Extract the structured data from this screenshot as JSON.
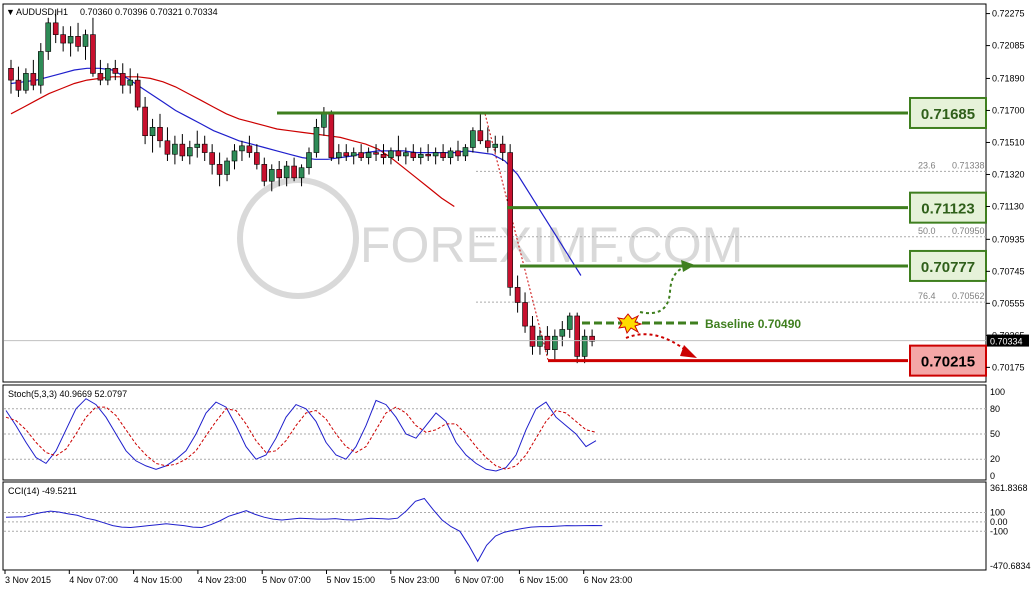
{
  "chart_data": {
    "type": "candlestick",
    "header": {
      "symbol": "AUDUSD,H1",
      "ohlc": "0.70360 0.70396 0.70321 0.70334"
    },
    "price_axis": {
      "range": [
        0.701,
        0.7232
      ],
      "ticks": [
        "0.72275",
        "0.72085",
        "0.71890",
        "0.71700",
        "0.71510",
        "0.71320",
        "0.71130",
        "0.70935",
        "0.70745",
        "0.70555",
        "0.70365",
        "0.70175"
      ],
      "current_price": "0.70334"
    },
    "time_axis": {
      "labels": [
        "3 Nov 2015",
        "4 Nov 07:00",
        "4 Nov 15:00",
        "4 Nov 23:00",
        "5 Nov 07:00",
        "5 Nov 15:00",
        "5 Nov 23:00",
        "6 Nov 07:00",
        "6 Nov 15:00",
        "6 Nov 23:00"
      ]
    },
    "candles": [
      [
        0.7195,
        0.72,
        0.718,
        0.7188
      ],
      [
        0.7188,
        0.7196,
        0.7178,
        0.7182
      ],
      [
        0.7182,
        0.7195,
        0.718,
        0.7192
      ],
      [
        0.7192,
        0.72,
        0.7182,
        0.7185
      ],
      [
        0.7185,
        0.721,
        0.718,
        0.7205
      ],
      [
        0.7205,
        0.7225,
        0.72,
        0.7222
      ],
      [
        0.7222,
        0.723,
        0.721,
        0.7215
      ],
      [
        0.7215,
        0.722,
        0.7205,
        0.721
      ],
      [
        0.721,
        0.722,
        0.7202,
        0.7214
      ],
      [
        0.7214,
        0.7222,
        0.7205,
        0.7208
      ],
      [
        0.7208,
        0.7218,
        0.72,
        0.7215
      ],
      [
        0.7215,
        0.7225,
        0.719,
        0.7192
      ],
      [
        0.7192,
        0.72,
        0.7185,
        0.7188
      ],
      [
        0.7188,
        0.7198,
        0.7185,
        0.7195
      ],
      [
        0.7195,
        0.72,
        0.7188,
        0.7192
      ],
      [
        0.7192,
        0.7198,
        0.718,
        0.7185
      ],
      [
        0.7185,
        0.7195,
        0.718,
        0.7188
      ],
      [
        0.7188,
        0.7192,
        0.717,
        0.7172
      ],
      [
        0.7172,
        0.7178,
        0.715,
        0.7155
      ],
      [
        0.7155,
        0.7165,
        0.7145,
        0.716
      ],
      [
        0.716,
        0.7168,
        0.7148,
        0.7152
      ],
      [
        0.7152,
        0.716,
        0.714,
        0.7144
      ],
      [
        0.7144,
        0.7155,
        0.7138,
        0.715
      ],
      [
        0.715,
        0.7156,
        0.714,
        0.7143
      ],
      [
        0.7143,
        0.7152,
        0.7138,
        0.7148
      ],
      [
        0.7148,
        0.7158,
        0.7142,
        0.715
      ],
      [
        0.715,
        0.7155,
        0.714,
        0.7145
      ],
      [
        0.7145,
        0.715,
        0.7132,
        0.7138
      ],
      [
        0.7138,
        0.7145,
        0.7125,
        0.7132
      ],
      [
        0.7132,
        0.7142,
        0.7128,
        0.714
      ],
      [
        0.714,
        0.715,
        0.7135,
        0.7146
      ],
      [
        0.7146,
        0.7152,
        0.714,
        0.7149
      ],
      [
        0.7149,
        0.7155,
        0.7142,
        0.7145
      ],
      [
        0.7145,
        0.715,
        0.7135,
        0.7138
      ],
      [
        0.7138,
        0.7142,
        0.7125,
        0.7128
      ],
      [
        0.7128,
        0.7138,
        0.7122,
        0.7135
      ],
      [
        0.7135,
        0.714,
        0.7125,
        0.713
      ],
      [
        0.713,
        0.714,
        0.7125,
        0.7137
      ],
      [
        0.7137,
        0.7142,
        0.7128,
        0.713
      ],
      [
        0.713,
        0.7138,
        0.7125,
        0.7136
      ],
      [
        0.7136,
        0.7148,
        0.7132,
        0.7145
      ],
      [
        0.7145,
        0.7165,
        0.7142,
        0.716
      ],
      [
        0.716,
        0.7172,
        0.7155,
        0.7168
      ],
      [
        0.7168,
        0.717,
        0.714,
        0.7142
      ],
      [
        0.7142,
        0.715,
        0.7138,
        0.7145
      ],
      [
        0.7145,
        0.715,
        0.714,
        0.7143
      ],
      [
        0.7143,
        0.7148,
        0.7138,
        0.7145
      ],
      [
        0.7145,
        0.715,
        0.714,
        0.7142
      ],
      [
        0.7142,
        0.7148,
        0.7138,
        0.7145
      ],
      [
        0.7145,
        0.715,
        0.714,
        0.7144
      ],
      [
        0.7144,
        0.715,
        0.7138,
        0.7142
      ],
      [
        0.7142,
        0.7148,
        0.7138,
        0.7146
      ],
      [
        0.7146,
        0.7155,
        0.714,
        0.7143
      ],
      [
        0.7143,
        0.7148,
        0.7138,
        0.7145
      ],
      [
        0.7145,
        0.715,
        0.714,
        0.7142
      ],
      [
        0.7142,
        0.7148,
        0.7138,
        0.7144
      ],
      [
        0.7144,
        0.715,
        0.714,
        0.7143
      ],
      [
        0.7143,
        0.7148,
        0.7138,
        0.7145
      ],
      [
        0.7145,
        0.715,
        0.714,
        0.7142
      ],
      [
        0.7142,
        0.7148,
        0.7138,
        0.7146
      ],
      [
        0.7146,
        0.7152,
        0.714,
        0.7143
      ],
      [
        0.7143,
        0.715,
        0.714,
        0.7148
      ],
      [
        0.7148,
        0.716,
        0.7145,
        0.7158
      ],
      [
        0.7158,
        0.7168,
        0.715,
        0.7152
      ],
      [
        0.7152,
        0.716,
        0.7145,
        0.7148
      ],
      [
        0.7148,
        0.7155,
        0.7145,
        0.715
      ],
      [
        0.715,
        0.7155,
        0.714,
        0.7145
      ],
      [
        0.7145,
        0.715,
        0.706,
        0.7065
      ],
      [
        0.7065,
        0.7072,
        0.705,
        0.7056
      ],
      [
        0.7056,
        0.7062,
        0.7038,
        0.7042
      ],
      [
        0.7042,
        0.7048,
        0.7025,
        0.703
      ],
      [
        0.703,
        0.704,
        0.7025,
        0.7036
      ],
      [
        0.7036,
        0.7042,
        0.7025,
        0.7028
      ],
      [
        0.7028,
        0.704,
        0.7022,
        0.7036
      ],
      [
        0.7036,
        0.7045,
        0.703,
        0.704
      ],
      [
        0.704,
        0.705,
        0.7035,
        0.7048
      ],
      [
        0.7048,
        0.705,
        0.702,
        0.7024
      ],
      [
        0.7024,
        0.704,
        0.702,
        0.7036
      ],
      [
        0.7036,
        0.704,
        0.703,
        0.7033
      ]
    ],
    "ma_blue": [
      0.7186,
      0.7187,
      0.7188,
      0.719,
      0.7192,
      0.7194,
      0.7195,
      0.7195,
      0.7194,
      0.719,
      0.7185,
      0.718,
      0.7175,
      0.717,
      0.7166,
      0.7162,
      0.7158,
      0.7155,
      0.7152,
      0.715,
      0.7148,
      0.7146,
      0.7144,
      0.7142,
      0.7141,
      0.7141,
      0.7142,
      0.7143,
      0.7145,
      0.7146,
      0.7146,
      0.7146,
      0.7145,
      0.7145,
      0.7145,
      0.7145,
      0.7146,
      0.7145,
      0.7144,
      0.714,
      0.7132,
      0.712,
      0.7108,
      0.7096,
      0.7084,
      0.7072
    ],
    "ma_red": [
      0.7168,
      0.7172,
      0.7176,
      0.718,
      0.7183,
      0.7186,
      0.7188,
      0.7189,
      0.719,
      0.719,
      0.719,
      0.7189,
      0.7187,
      0.7184,
      0.718,
      0.7176,
      0.7172,
      0.7168,
      0.7165,
      0.7163,
      0.7161,
      0.7159,
      0.7158,
      0.7157,
      0.7156,
      0.7155,
      0.7154,
      0.7152,
      0.715,
      0.7147,
      0.7142,
      0.7136,
      0.713,
      0.7124,
      0.7118,
      0.7113
    ],
    "levels": [
      {
        "label": "0.71685",
        "price": 0.71685,
        "color": "#3f7f1f"
      },
      {
        "label": "0.71123",
        "price": 0.71123,
        "color": "#3f7f1f"
      },
      {
        "label": "0.70777",
        "price": 0.70777,
        "color": "#3f7f1f"
      },
      {
        "label": "0.70215",
        "price": 0.70215,
        "color": "#cc0000"
      }
    ],
    "baseline_label": "Baseline 0.70490",
    "fib_levels": [
      {
        "label": "23.6",
        "value": "0.71338",
        "price": 0.71338
      },
      {
        "label": "50.0",
        "value": "0.70950",
        "price": 0.7095
      },
      {
        "label": "76.4",
        "value": "0.70562",
        "price": 0.70562
      }
    ],
    "watermark": "FOREXIMF.COM",
    "stoch": {
      "label": "Stoch(5,3,3) 40.9669 52.0797",
      "ticks": [
        "100",
        "80",
        "50",
        "20",
        "0"
      ],
      "k": [
        78,
        60,
        40,
        22,
        15,
        30,
        55,
        80,
        92,
        85,
        70,
        50,
        30,
        18,
        12,
        8,
        12,
        20,
        30,
        50,
        75,
        88,
        82,
        60,
        35,
        20,
        25,
        45,
        70,
        85,
        80,
        65,
        40,
        25,
        20,
        35,
        60,
        90,
        85,
        70,
        50,
        45,
        60,
        75,
        65,
        40,
        25,
        15,
        8,
        6,
        10,
        25,
        55,
        80,
        88,
        70,
        60,
        50,
        35,
        42
      ],
      "d": [
        70,
        66,
        55,
        40,
        28,
        24,
        32,
        50,
        70,
        82,
        82,
        72,
        55,
        38,
        25,
        15,
        12,
        14,
        20,
        30,
        48,
        65,
        80,
        78,
        62,
        42,
        28,
        30,
        42,
        60,
        75,
        78,
        68,
        50,
        35,
        28,
        35,
        55,
        75,
        82,
        75,
        60,
        52,
        55,
        62,
        62,
        50,
        35,
        22,
        12,
        8,
        12,
        25,
        45,
        65,
        78,
        75,
        65,
        55,
        52
      ],
      "levels": [
        80,
        50,
        20
      ]
    },
    "cci": {
      "label": "CCI(14) -49.5211",
      "ticks": [
        "361.8368",
        "100",
        "0.00",
        "-100",
        "-470.6834"
      ],
      "values": [
        50,
        52,
        55,
        80,
        100,
        115,
        105,
        85,
        70,
        40,
        20,
        -10,
        -40,
        -55,
        -60,
        -50,
        -40,
        -30,
        -20,
        -30,
        -40,
        -55,
        -60,
        -30,
        10,
        60,
        90,
        120,
        80,
        50,
        30,
        20,
        30,
        40,
        35,
        30,
        30,
        35,
        25,
        20,
        30,
        40,
        35,
        30,
        40,
        120,
        220,
        250,
        130,
        20,
        -50,
        -100,
        -250,
        -420,
        -250,
        -150,
        -110,
        -90,
        -70,
        -55,
        -50,
        -50,
        -45,
        -40,
        -42,
        -40,
        -38,
        -40
      ],
      "range": [
        -470.6834,
        361.8368
      ]
    }
  }
}
